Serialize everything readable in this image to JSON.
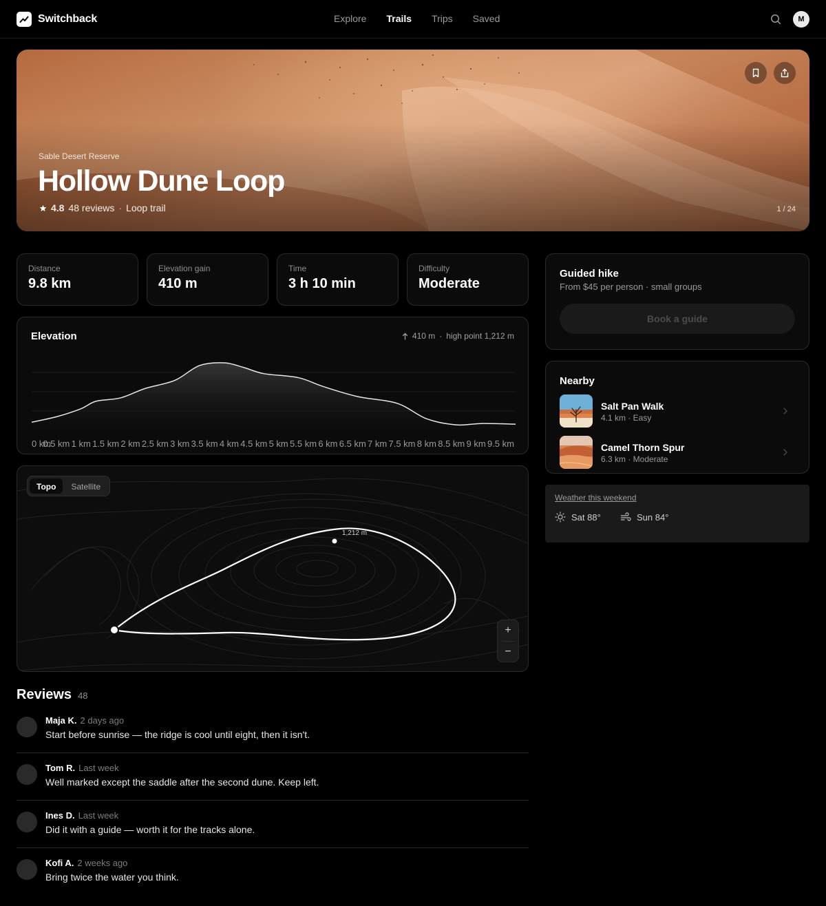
{
  "app": {
    "name": "Switchback"
  },
  "nav": {
    "items": [
      "Explore",
      "Trails",
      "Trips",
      "Saved"
    ],
    "active": "Trails"
  },
  "user": {
    "initial": "M"
  },
  "hero": {
    "eyebrow": "Sable Desert Reserve",
    "title": "Hollow Dune Loop",
    "rating": "4.8",
    "reviews": "48 reviews",
    "separator": "·",
    "trail_type": "Loop trail",
    "photo_counter": "1 / 24"
  },
  "stats": [
    {
      "label": "Distance",
      "value": "9.8 km"
    },
    {
      "label": "Elevation gain",
      "value": "410 m"
    },
    {
      "label": "Time",
      "value": "3 h 10 min"
    },
    {
      "label": "Difficulty",
      "value": "Moderate"
    }
  ],
  "elevation": {
    "title": "Elevation",
    "gain": "410 m",
    "high_point": "high point 1,212 m"
  },
  "chart_data": {
    "type": "area",
    "title": "Elevation",
    "x_unit": "km",
    "x": [
      0,
      0.5,
      1,
      1.5,
      2,
      2.5,
      3,
      3.5,
      4,
      4.5,
      5,
      5.5,
      6,
      6.5,
      7,
      7.5,
      8,
      8.5,
      9,
      9.5
    ],
    "x_tick_labels": [
      "0 km",
      "0.5 km",
      "1 km",
      "1.5 km",
      "2 km",
      "2.5 km",
      "3 km",
      "3.5 km",
      "4 km",
      "4.5 km",
      "5 km",
      "5.5 km",
      "6 km",
      "6.5 km",
      "7 km",
      "7.5 km",
      "8 km",
      "8.5 km",
      "9 km",
      "9.5 km"
    ],
    "profile_x_km": [
      0,
      0.5,
      1,
      1.3,
      1.8,
      2.3,
      2.9,
      3.4,
      3.9,
      4.3,
      4.7,
      5.4,
      5.9,
      6.6,
      7.4,
      8.0,
      8.6,
      9.1,
      9.8
    ],
    "profile_y": [
      0.12,
      0.2,
      0.32,
      0.43,
      0.48,
      0.62,
      0.74,
      0.96,
      1.0,
      0.93,
      0.84,
      0.78,
      0.65,
      0.5,
      0.4,
      0.17,
      0.08,
      0.1,
      0.09
    ],
    "y_note": "relative elevation, 1.0 = high point",
    "grid": true,
    "high_point": "1,212 m"
  },
  "map": {
    "modes": [
      "Topo",
      "Satellite"
    ],
    "active_mode": "Topo",
    "peak_label": "1,212 m",
    "zoom_in": "+",
    "zoom_out": "−"
  },
  "reviews": {
    "title": "Reviews",
    "count": "48",
    "items": [
      {
        "name": "Maja K.",
        "when": "2 days ago",
        "text": "Start before sunrise — the ridge is cool until eight, then it isn't."
      },
      {
        "name": "Tom R.",
        "when": "Last week",
        "text": "Well marked except the saddle after the second dune. Keep left."
      },
      {
        "name": "Ines D.",
        "when": "Last week",
        "text": "Did it with a guide — worth it for the tracks alone."
      },
      {
        "name": "Kofi A.",
        "when": "2 weeks ago",
        "text": "Bring twice the water you think."
      }
    ]
  },
  "guided": {
    "title": "Guided hike",
    "subtitle": "From $45 per person · small groups",
    "button": "Book a guide"
  },
  "nearby": {
    "title": "Nearby",
    "items": [
      {
        "name": "Salt Pan Walk",
        "meta": "4.1 km · Easy"
      },
      {
        "name": "Camel Thorn Spur",
        "meta": "6.3 km · Moderate"
      }
    ]
  },
  "weather": {
    "link": "Weather this weekend",
    "days": [
      {
        "label": "Sat 88°",
        "icon": "sun-icon"
      },
      {
        "label": "Sun 84°",
        "icon": "wind-icon"
      }
    ]
  },
  "colors": {
    "background": "#000000",
    "card": "#0b0b0b",
    "border": "#2a2a2a",
    "hero_sand": "#c98a60"
  },
  "icons": [
    "trend-icon",
    "search-icon",
    "bookmark-icon",
    "share-icon",
    "star-icon",
    "arrow-up-icon",
    "chevron-right-icon"
  ]
}
